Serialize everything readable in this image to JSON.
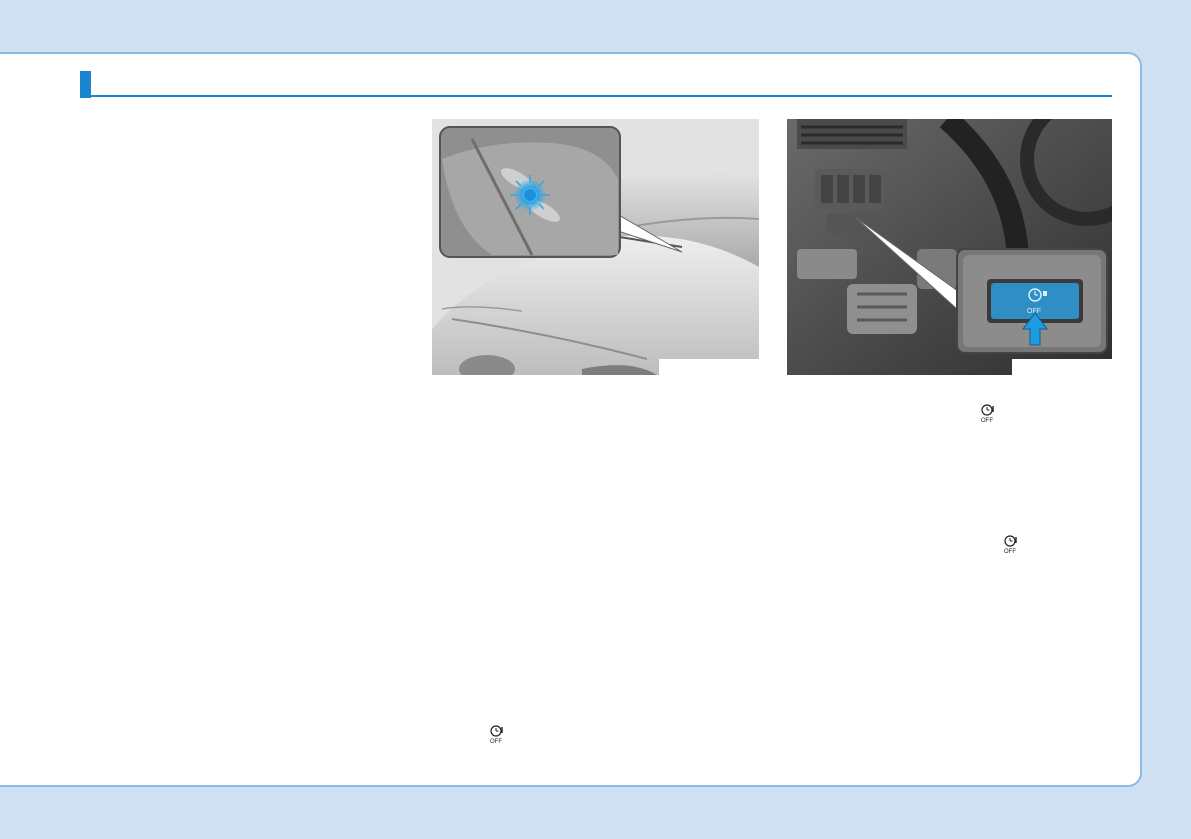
{
  "colors": {
    "page_background": "#cfe0f3",
    "accent": "#1b86cf",
    "panel_border": "#8fb8e2",
    "indicator_light": "#2aa7e8",
    "switch_face": "#2f8fc4"
  },
  "icons": {
    "figure_left": "windshield-indicator-light",
    "figure_right": "dashboard-off-switch",
    "inline_symbol": "clock-off-icon"
  },
  "off_symbol_text": "OFF"
}
